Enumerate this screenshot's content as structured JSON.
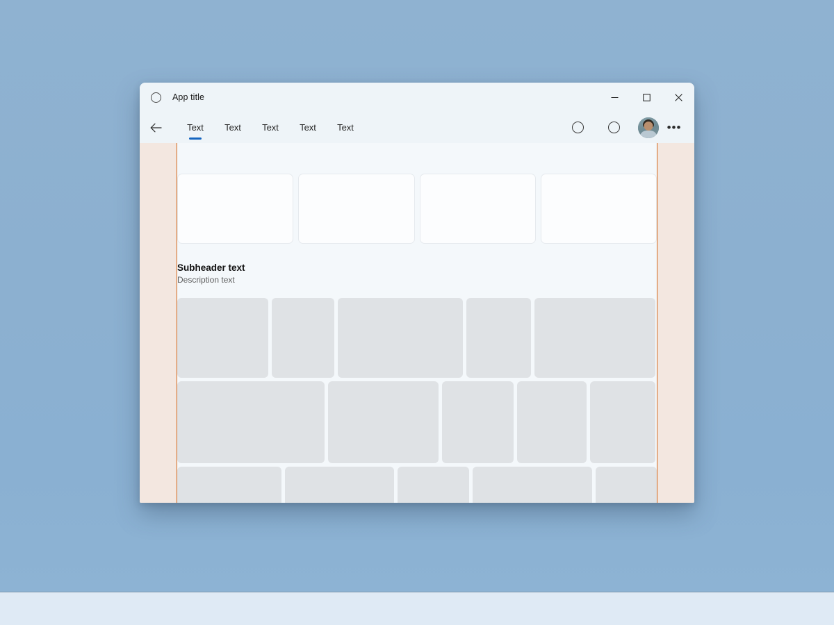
{
  "window": {
    "title": "App title",
    "app_icon": "circle-outline-icon",
    "controls": {
      "minimize": "minimize-icon",
      "maximize": "maximize-icon",
      "close": "close-icon"
    }
  },
  "commandbar": {
    "back_icon": "back-arrow-icon",
    "tabs": [
      {
        "label": "Text",
        "selected": true
      },
      {
        "label": "Text",
        "selected": false
      },
      {
        "label": "Text",
        "selected": false
      },
      {
        "label": "Text",
        "selected": false
      },
      {
        "label": "Text",
        "selected": false
      }
    ],
    "actions": [
      {
        "icon": "circle-outline-icon",
        "name": "header-action-1"
      },
      {
        "icon": "circle-outline-icon",
        "name": "header-action-2"
      }
    ],
    "avatar": "user-avatar",
    "more_label": "•••"
  },
  "content": {
    "cards": [
      {
        "id": "card-1"
      },
      {
        "id": "card-2"
      },
      {
        "id": "card-3"
      },
      {
        "id": "card-4"
      }
    ],
    "subheader": {
      "title": "Subheader text",
      "description": "Description text"
    },
    "tile_rows": [
      {
        "heights": 115,
        "tiles": [
          131,
          90,
          180,
          93,
          174
        ]
      },
      {
        "heights": 118,
        "tiles": [
          212,
          159,
          103,
          100,
          94
        ]
      },
      {
        "heights": 64,
        "tiles": [
          153,
          159,
          105,
          175,
          90
        ]
      }
    ]
  },
  "colors": {
    "accent": "#1565c0",
    "rail": "#f3e7e0",
    "rail_border": "#d2691e",
    "content_bg": "#f4f8fb",
    "card_bg": "#fcfdfe",
    "tile_bg": "#dfe2e5",
    "chrome_bg": "#eef4f8",
    "desktop_bg": "#8cb0d0",
    "taskbar_bg": "#dfeaf5"
  }
}
